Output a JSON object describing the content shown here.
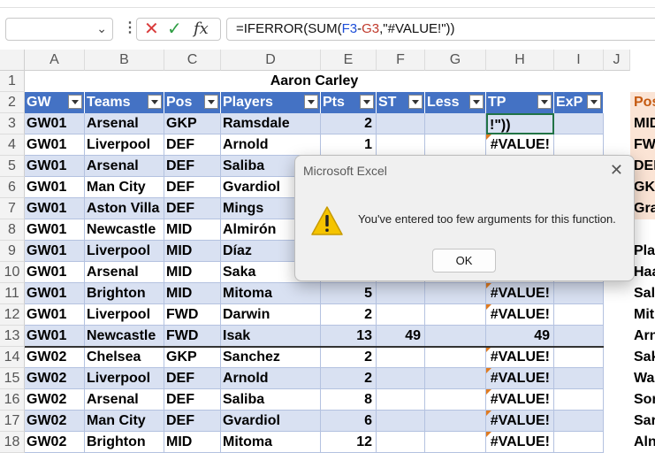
{
  "formula_bar": {
    "name_box": "",
    "formula_prefix": "=IFERROR(SUM(",
    "formula_ref1": "F3",
    "formula_op": "-",
    "formula_ref2": "G3",
    "formula_suffix": ",\"#VALUE!\"))",
    "cancel_glyph": "✕",
    "enter_glyph": "✓",
    "fx_glyph": "fx"
  },
  "columns": [
    "A",
    "B",
    "C",
    "D",
    "E",
    "F",
    "G",
    "H",
    "I",
    "J"
  ],
  "title": "Aaron Carley",
  "headers": {
    "gw": "GW",
    "teams": "Teams",
    "pos": "Pos",
    "players": "Players",
    "pts": "Pts",
    "st": "ST",
    "less": "Less",
    "tp": "TP",
    "exp": "ExP"
  },
  "rows": [
    {
      "n": "3",
      "gw": "GW01",
      "team": "Arsenal",
      "pos": "GKP",
      "player": "Ramsdale",
      "pts": "2",
      "st": "",
      "less": "",
      "tp": "!\"))",
      "side": "MID"
    },
    {
      "n": "4",
      "gw": "GW01",
      "team": "Liverpool",
      "pos": "DEF",
      "player": "Arnold",
      "pts": "1",
      "st": "",
      "less": "",
      "tp": "#VALUE!",
      "side": "FWD"
    },
    {
      "n": "5",
      "gw": "GW01",
      "team": "Arsenal",
      "pos": "DEF",
      "player": "Saliba",
      "pts": "",
      "st": "",
      "less": "",
      "tp": "",
      "side": "DEF"
    },
    {
      "n": "6",
      "gw": "GW01",
      "team": "Man City",
      "pos": "DEF",
      "player": "Gvardiol",
      "pts": "",
      "st": "",
      "less": "",
      "tp": "",
      "side": "GKP"
    },
    {
      "n": "7",
      "gw": "GW01",
      "team": "Aston Villa",
      "pos": "DEF",
      "player": "Mings",
      "pts": "",
      "st": "",
      "less": "",
      "tp": "",
      "side": "Gra"
    },
    {
      "n": "8",
      "gw": "GW01",
      "team": "Newcastle",
      "pos": "MID",
      "player": "Almirón",
      "pts": "",
      "st": "",
      "less": "",
      "tp": "",
      "side": ""
    },
    {
      "n": "9",
      "gw": "GW01",
      "team": "Liverpool",
      "pos": "MID",
      "player": "Díaz",
      "pts": "",
      "st": "",
      "less": "",
      "tp": "",
      "side": "Play"
    },
    {
      "n": "10",
      "gw": "GW01",
      "team": "Arsenal",
      "pos": "MID",
      "player": "Saka",
      "pts": "",
      "st": "",
      "less": "",
      "tp": "",
      "side": "Haa"
    },
    {
      "n": "11",
      "gw": "GW01",
      "team": "Brighton",
      "pos": "MID",
      "player": "Mitoma",
      "pts": "5",
      "st": "",
      "less": "",
      "tp": "#VALUE!",
      "side": "Sali"
    },
    {
      "n": "12",
      "gw": "GW01",
      "team": "Liverpool",
      "pos": "FWD",
      "player": "Darwin",
      "pts": "2",
      "st": "",
      "less": "",
      "tp": "#VALUE!",
      "side": "Mit"
    },
    {
      "n": "13",
      "gw": "GW01",
      "team": "Newcastle",
      "pos": "FWD",
      "player": "Isak",
      "pts": "13",
      "st": "49",
      "less": "",
      "tp": "49",
      "side": "Arn"
    },
    {
      "n": "14",
      "gw": "GW02",
      "team": "Chelsea",
      "pos": "GKP",
      "player": "Sanchez",
      "pts": "2",
      "st": "",
      "less": "",
      "tp": "#VALUE!",
      "side": "Sak"
    },
    {
      "n": "15",
      "gw": "GW02",
      "team": "Liverpool",
      "pos": "DEF",
      "player": "Arnold",
      "pts": "2",
      "st": "",
      "less": "",
      "tp": "#VALUE!",
      "side": "Wa"
    },
    {
      "n": "16",
      "gw": "GW02",
      "team": "Arsenal",
      "pos": "DEF",
      "player": "Saliba",
      "pts": "8",
      "st": "",
      "less": "",
      "tp": "#VALUE!",
      "side": "Son"
    },
    {
      "n": "17",
      "gw": "GW02",
      "team": "Man City",
      "pos": "DEF",
      "player": "Gvardiol",
      "pts": "6",
      "st": "",
      "less": "",
      "tp": "#VALUE!",
      "side": "Sar"
    },
    {
      "n": "18",
      "gw": "GW02",
      "team": "Brighton",
      "pos": "MID",
      "player": "Mitoma",
      "pts": "12",
      "st": "",
      "less": "",
      "tp": "#VALUE!",
      "side": "Aln"
    }
  ],
  "side_header": "Pos",
  "dialog": {
    "title": "Microsoft Excel",
    "message": "You've entered too few arguments for this function.",
    "ok_label": "OK",
    "close_glyph": "✕",
    "icon": "warning-icon"
  },
  "colors": {
    "header_blue": "#4472c4",
    "band": "#d9e1f2",
    "error_marker": "#e07b20"
  }
}
